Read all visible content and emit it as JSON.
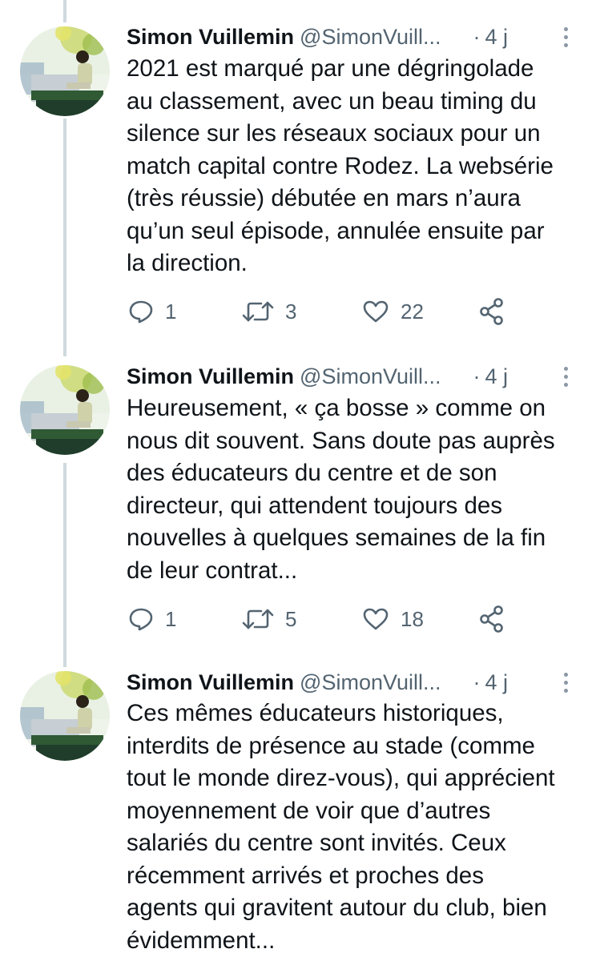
{
  "tweets": [
    {
      "author": "Simon Vuillemin",
      "handle": "@SimonVuill...",
      "separator": "·",
      "time": "4 j",
      "lines": [
        "2021 est marqué par une dégringolade",
        "au classement, avec un beau timing du",
        "silence sur les réseaux sociaux pour un",
        "match capital contre Rodez. La websérie",
        "(très réussie) débutée en mars n’aura",
        "qu’un seul épisode, annulée ensuite par",
        "la direction."
      ],
      "replies": "1",
      "retweets": "3",
      "likes": "22"
    },
    {
      "author": "Simon Vuillemin",
      "handle": "@SimonVuill...",
      "separator": "·",
      "time": "4 j",
      "lines": [
        "Heureusement, « ça bosse » comme on",
        "nous dit souvent. Sans doute pas auprès",
        "des éducateurs du centre et de son",
        "directeur, qui attendent toujours des",
        "nouvelles à quelques semaines de la fin",
        "de leur contrat..."
      ],
      "replies": "1",
      "retweets": "5",
      "likes": "18"
    },
    {
      "author": "Simon Vuillemin",
      "handle": "@SimonVuill...",
      "separator": "·",
      "time": "4 j",
      "lines": [
        "Ces mêmes éducateurs historiques,",
        "interdits de présence au stade (comme",
        "tout le monde direz-vous), qui apprécient",
        "moyennement de voir que d’autres",
        "salariés du centre sont invités. Ceux",
        "récemment arrivés et proches des",
        "agents qui gravitent autour du club, bien",
        "évidemment..."
      ]
    }
  ],
  "icons": {
    "reply": "reply-icon",
    "retweet": "retweet-icon",
    "like": "heart-icon",
    "share": "share-icon",
    "more": "more-options-icon"
  },
  "colors": {
    "text": "#0f1419",
    "secondary": "#536471",
    "thread_line": "#cfd9de"
  }
}
